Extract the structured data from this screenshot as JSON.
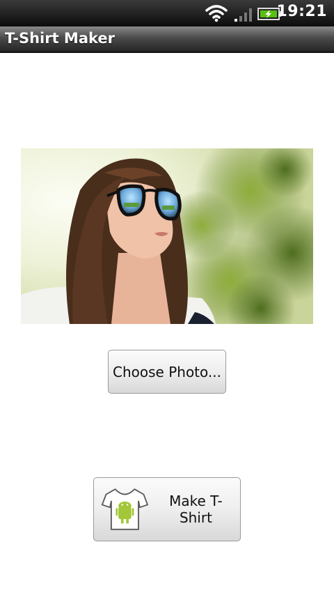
{
  "status_bar": {
    "time": "19:21",
    "icons": [
      "wifi-icon",
      "signal-icon",
      "battery-charging-icon"
    ]
  },
  "app": {
    "title": "T-Shirt Maker"
  },
  "photo": {
    "subject": "woman-with-sunglasses-photo"
  },
  "buttons": {
    "choose_label": "Choose Photo...",
    "make_label": "Make T-Shirt",
    "make_icon": "tshirt-android-icon"
  },
  "colors": {
    "status_bar": "#0c0c0c",
    "title_bar": "#4a4a4a",
    "background": "#ffffff",
    "battery_fill": "#58c010"
  }
}
